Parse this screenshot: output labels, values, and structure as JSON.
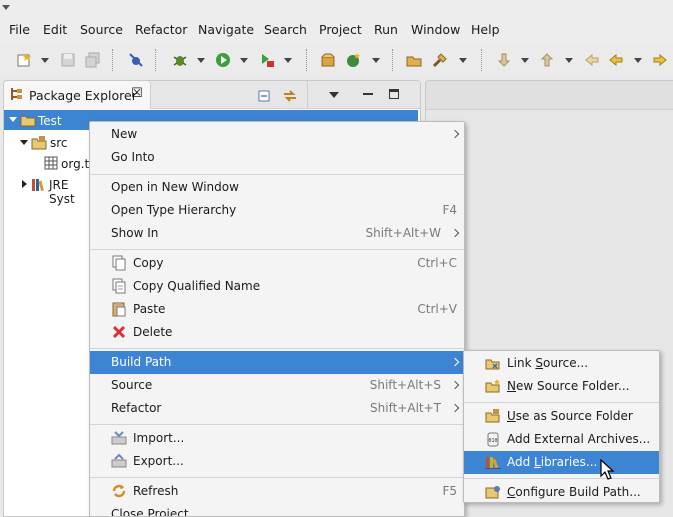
{
  "colors": {
    "selection": "#3d85d3",
    "menu_bg": "#f4f4f4",
    "accelerator": "#7a7a7a"
  },
  "menubar": {
    "items": [
      "File",
      "Edit",
      "Source",
      "Refactor",
      "Navigate",
      "Search",
      "Project",
      "Run",
      "Window",
      "Help"
    ]
  },
  "toolbar": {
    "icons": [
      "new-wizard-icon",
      "save-icon",
      "save-all-icon",
      "skip-breakpoints-icon",
      "debug-icon",
      "run-icon",
      "external-tools-icon",
      "new-package-icon",
      "new-class-icon",
      "open-type-icon",
      "search-icon",
      "next-annotation-icon",
      "previous-annotation-icon",
      "last-edit-icon",
      "back-icon",
      "forward-icon"
    ]
  },
  "view": {
    "tab_title": "Package Explorer",
    "tab_close": "☒"
  },
  "tree": {
    "project": "Test",
    "src": "src",
    "package": "org.te",
    "jre": "JRE Syst"
  },
  "context_menu": {
    "new": "New",
    "go_into": "Go Into",
    "open_new_window": "Open in New Window",
    "open_type_hierarchy": "Open Type Hierarchy",
    "open_type_hierarchy_acc": "F4",
    "show_in": "Show In",
    "show_in_acc": "Shift+Alt+W",
    "copy": "Copy",
    "copy_acc": "Ctrl+C",
    "copy_qualified": "Copy Qualified Name",
    "paste": "Paste",
    "paste_acc": "Ctrl+V",
    "delete": "Delete",
    "build_path": "Build Path",
    "source": "Source",
    "source_acc": "Shift+Alt+S",
    "refactor": "Refactor",
    "refactor_acc": "Shift+Alt+T",
    "import": "Import...",
    "export": "Export...",
    "refresh": "Refresh",
    "refresh_acc": "F5",
    "close_project": "Close Project"
  },
  "submenu": {
    "link_source_pre": "Link ",
    "link_source_ul": "S",
    "link_source_post": "ource...",
    "new_source_folder_pre": "",
    "new_source_folder_ul": "N",
    "new_source_folder_post": "ew Source Folder...",
    "use_as_source_pre": "",
    "use_as_source_ul": "U",
    "use_as_source_post": "se as Source Folder",
    "add_external": "Add External Archives...",
    "add_libraries_pre": "Add ",
    "add_libraries_ul": "L",
    "add_libraries_post": "ibraries...",
    "configure_pre": "",
    "configure_ul": "C",
    "configure_post": "onfigure Build Path..."
  }
}
